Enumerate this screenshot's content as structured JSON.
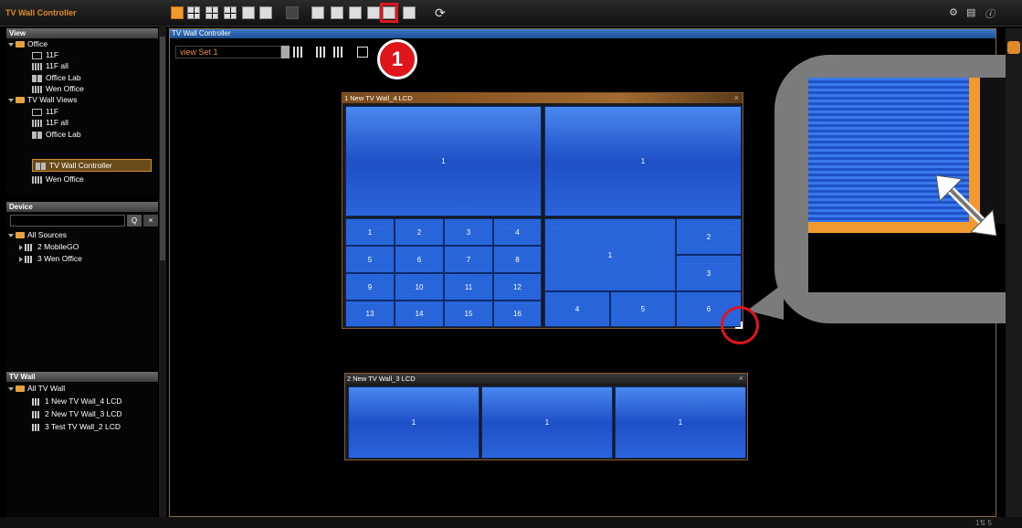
{
  "app": {
    "title": "TV Wall Controller"
  },
  "toolbar": {
    "marker": "1"
  },
  "panels": {
    "view": {
      "header": "View"
    },
    "device": {
      "header": "Device"
    },
    "tvwall": {
      "header": "TV Wall"
    }
  },
  "view_tree": [
    {
      "label": "Office"
    },
    {
      "label": "11F"
    },
    {
      "label": "11F all"
    },
    {
      "label": "Office Lab"
    },
    {
      "label": "Wen Office"
    },
    {
      "label": "TV Wall Views"
    },
    {
      "label": "11F"
    },
    {
      "label": "11F all"
    },
    {
      "label": "Office Lab"
    },
    {
      "label": "TV Wall Controller"
    },
    {
      "label": "Wen Office"
    }
  ],
  "device_tree": [
    {
      "label": "All Sources"
    },
    {
      "label": "2 MobileGO"
    },
    {
      "label": "3 Wen Office"
    }
  ],
  "search_buttons": {
    "search": "Q",
    "clear": "×"
  },
  "tvwall_tree": [
    {
      "label": "All TV Wall"
    },
    {
      "label": "1 New TV Wall_4 LCD"
    },
    {
      "label": "2 New TV Wall_3 LCD"
    },
    {
      "label": "3 Test TV Wall_2 LCD"
    }
  ],
  "main": {
    "header": "TV Wall Controller",
    "view_select": "view Set 1"
  },
  "wall1": {
    "title": "1 New TV Wall_4 LCD",
    "close": "×",
    "top_left": "1",
    "top_right": "1",
    "grid": [
      "1",
      "2",
      "3",
      "4",
      "5",
      "6",
      "7",
      "8",
      "9",
      "10",
      "11",
      "12",
      "13",
      "14",
      "15",
      "16"
    ],
    "br": {
      "big": "1",
      "c2": "2",
      "c3": "3",
      "c4": "4",
      "c5": "5",
      "c6": "6"
    }
  },
  "wall2": {
    "title": "2 New TV Wall_3 LCD",
    "close": "×",
    "cells": [
      "1",
      "1",
      "1"
    ]
  },
  "status": {
    "zoom": "1⇅ 5"
  }
}
